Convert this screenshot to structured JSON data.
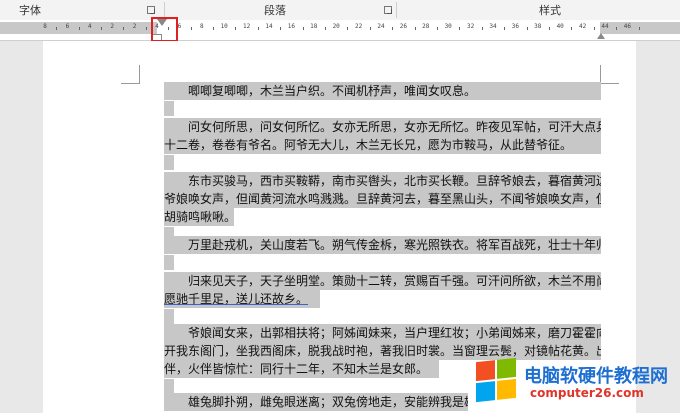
{
  "ribbon": {
    "groups": [
      {
        "name": "字体"
      },
      {
        "name": "段落"
      },
      {
        "name": "样式"
      }
    ]
  },
  "ruler": {
    "labels": [
      "8",
      "6",
      "4",
      "2",
      "2",
      "4",
      "6",
      "8",
      "10",
      "12",
      "14",
      "16",
      "18",
      "20",
      "22",
      "24",
      "26",
      "28",
      "30",
      "32",
      "34",
      "36",
      "38",
      "40",
      "42",
      "44",
      "46"
    ]
  },
  "document": {
    "paragraphs": [
      {
        "lines": [
          "唧唧复唧唧，木兰当户织。不闻机杼声，唯闻女叹息。"
        ]
      },
      {
        "lines": [
          "问女何所思，问女何所忆。女亦无所思，女亦无所忆。昨夜见军帖，可汗大点兵，军书",
          "十二卷，卷卷有爷名。阿爷无大儿，木兰无长兄，愿为市鞍马，从此替爷征。"
        ]
      },
      {
        "lines": [
          "东市买骏马，西市买鞍鞯，南市买辔头，北市买长鞭。旦辞爷娘去，暮宿黄河边，不闻",
          "爷娘唤女声，但闻黄河流水鸣溅溅。旦辞黄河去，暮至黑山头，不闻爷娘唤女声，但闻燕山",
          "胡骑鸣啾啾。"
        ]
      },
      {
        "lines": [
          "万里赴戎机，关山度若飞。朔气传金柝，寒光照铁衣。将军百战死，壮士十年归。"
        ]
      },
      {
        "lines": [
          "归来见天子，天子坐明堂。策勋十二转，赏赐百千强。可汗问所欲，木兰不用尚书郎，",
          "愿驰千里足，送儿还故乡。"
        ]
      },
      {
        "lines": [
          "爷娘闻女来，出郭相扶将；阿姊闻妹来，当户理红妆；小弟闻姊来，磨刀霍霍向猪羊。",
          "开我东阁门，坐我西阁床，脱我战时袍，著我旧时裳。当窗理云鬓，对镜帖花黄。出门看火",
          "伴，火伴皆惊忙：同行十二年，不知木兰是女郎。"
        ]
      },
      {
        "lines": [
          "雄兔脚扑朔，雌兔眼迷离；双兔傍地走，安能辨我是雄雌？"
        ]
      }
    ]
  },
  "watermark": {
    "title": "电脑软硬件教程网",
    "url": "computer26.com",
    "logo_colors": [
      "#f25022",
      "#7fba00",
      "#00a4ef",
      "#ffb900"
    ]
  }
}
